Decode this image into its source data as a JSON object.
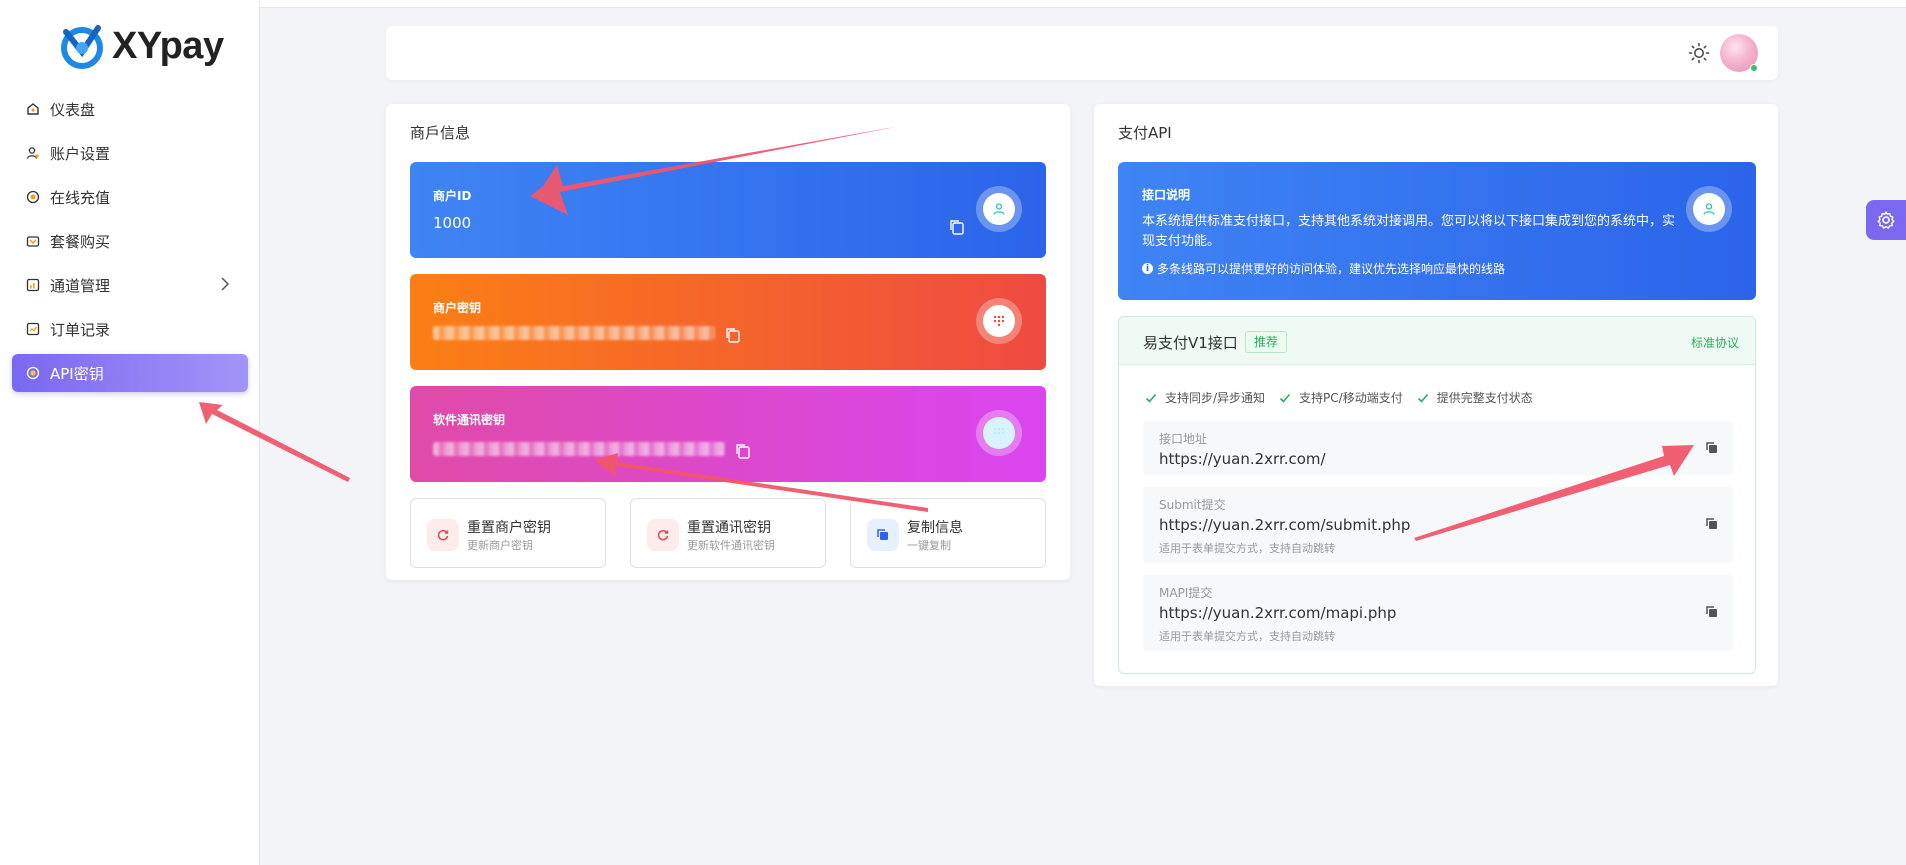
{
  "brand": {
    "name": "XYpay"
  },
  "sidebar": {
    "items": [
      {
        "label": "仪表盘",
        "icon": "dashboard-icon"
      },
      {
        "label": "账户设置",
        "icon": "user-icon"
      },
      {
        "label": "在线充值",
        "icon": "coin-icon"
      },
      {
        "label": "套餐购买",
        "icon": "cart-icon"
      },
      {
        "label": "通道管理",
        "icon": "chart-icon"
      },
      {
        "label": "订单记录",
        "icon": "list-icon"
      },
      {
        "label": "API密钥",
        "icon": "key-icon",
        "active": true
      }
    ]
  },
  "merchant": {
    "title": "商戶信息",
    "id_card": {
      "label": "商户ID",
      "value": "1000"
    },
    "key_card": {
      "label": "商户密钥"
    },
    "soft_card": {
      "label": "软件通讯密钥"
    },
    "actions": [
      {
        "title": "重置商户密钥",
        "subtitle": "更新商户密钥"
      },
      {
        "title": "重置通讯密钥",
        "subtitle": "更新软件通讯密钥"
      },
      {
        "title": "复制信息",
        "subtitle": "一键复制"
      }
    ]
  },
  "payapi": {
    "title": "支付API",
    "info": {
      "label": "接口说明",
      "desc": "本系统提供标准支付接口，支持其他系统对接调用。您可以将以下接口集成到您的系统中，实现支付功能。",
      "note": "多条线路可以提供更好的访问体验，建议优先选择响应最快的线路"
    },
    "api": {
      "name": "易支付V1接口",
      "tag": "推荐",
      "std": "标准协议",
      "features": [
        "支持同步/异步通知",
        "支持PC/移动端支付",
        "提供完整支付状态"
      ],
      "endpoints": [
        {
          "key": "接口地址",
          "url": "https://yuan.2xrr.com/",
          "sub": ""
        },
        {
          "key": "Submit提交",
          "url": "https://yuan.2xrr.com/submit.php",
          "sub": "适用于表单提交方式，支持自动跳转"
        },
        {
          "key": "MAPI提交",
          "url": "https://yuan.2xrr.com/mapi.php",
          "sub": "适用于表单提交方式，支持自动跳转"
        }
      ]
    }
  },
  "colors": {
    "accent": "#7a68f0",
    "blue": "#2b64ea",
    "orange": "#f97a16",
    "pink": "#df47c4",
    "green": "#2dad5c",
    "arrow": "#f0566a"
  }
}
